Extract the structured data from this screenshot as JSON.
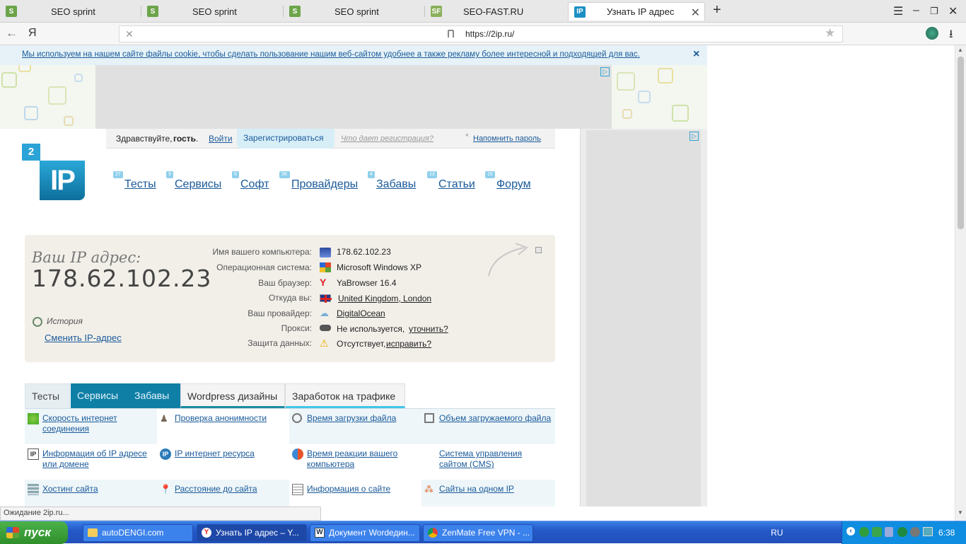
{
  "browser": {
    "tabs": [
      {
        "title": "SEO sprint"
      },
      {
        "title": "SEO sprint"
      },
      {
        "title": "SEO sprint"
      },
      {
        "title": "SEO-FAST.RU"
      },
      {
        "title": "Узнать IP адрес"
      }
    ],
    "back_glyph": "←",
    "yandex_glyph": "Я",
    "url": "https://2ip.ru/",
    "new_tab_glyph": "+"
  },
  "cookie": {
    "text": "Мы используем на нашем сайте файлы cookie, чтобы сделать пользование нашим веб-сайтом удобнее а также рекламу более интересной и подходящей для вас.",
    "close": "×"
  },
  "login": {
    "greeting": "Здравствуйте,",
    "guest": "гость",
    "login_link": "Войти",
    "register": "Зарегистрироваться",
    "what_gives": "Что дает регистрация?",
    "asterisk": "*",
    "remind": "Напомнить пароль"
  },
  "logo": {
    "digit": "2",
    "text": "IP"
  },
  "nav": [
    {
      "label": "Тесты",
      "badge": "27"
    },
    {
      "label": "Сервисы",
      "badge": "9"
    },
    {
      "label": "Софт",
      "badge": "5"
    },
    {
      "label": "Провайдеры",
      "badge": "3K"
    },
    {
      "label": "Забавы",
      "badge": "4"
    },
    {
      "label": "Статьи",
      "badge": "13"
    },
    {
      "label": "Форум",
      "badge": "15"
    }
  ],
  "ip": {
    "label": "Ваш IP адрес:",
    "address": "178.62.102.23",
    "history": "История",
    "change": "Сменить IP-адрес"
  },
  "info": {
    "computer_name_label": "Имя вашего компьютера:",
    "computer_name": "178.62.102.23",
    "os_label": "Операционная система:",
    "os": "Microsoft Windows XP",
    "browser_label": "Ваш браузер:",
    "browser": "YaBrowser 16.4",
    "from_label": "Откуда вы:",
    "from": "United Kingdom, London",
    "provider_label": "Ваш провайдер:",
    "provider": "DigitalOcean",
    "proxy_label": "Прокси:",
    "proxy": "Не используется,",
    "proxy_link": "уточнить?",
    "protection_label": "Защита данных:",
    "protection": "Отсутствует,",
    "protection_link": "исправить?"
  },
  "section_tabs": [
    "Тесты",
    "Сервисы",
    "Забавы",
    "Wordpress дизайны",
    "Заработок на трафике"
  ],
  "services": [
    "Скорость интернет соединения",
    "Проверка анонимности",
    "Время загрузки файла",
    "Объем загружаемого файла",
    "Информация об IP адресе или домене",
    "IP интернет ресурса",
    "Время реакции вашего компьютера",
    "Система управления сайтом (CMS)",
    "Хостинг сайта",
    "Расстояние до сайта",
    "Информация о сайте",
    "Сайты на одном IP"
  ],
  "status": "Ожидание 2ip.ru...",
  "taskbar": {
    "start": "пуск",
    "tasks": [
      "autoDENGI.com",
      "Узнать IP адрес – Y...",
      "Документ Wordедин...",
      "ZenMate Free VPN - ..."
    ],
    "lang": "RU",
    "time": "6:38"
  },
  "colors": {
    "accent": "#2ca3d6",
    "tab_active": "#0f7fa6",
    "link": "#1a5a9a",
    "ipbox_bg": "#f2efe9",
    "taskbar": "#2459c9"
  }
}
